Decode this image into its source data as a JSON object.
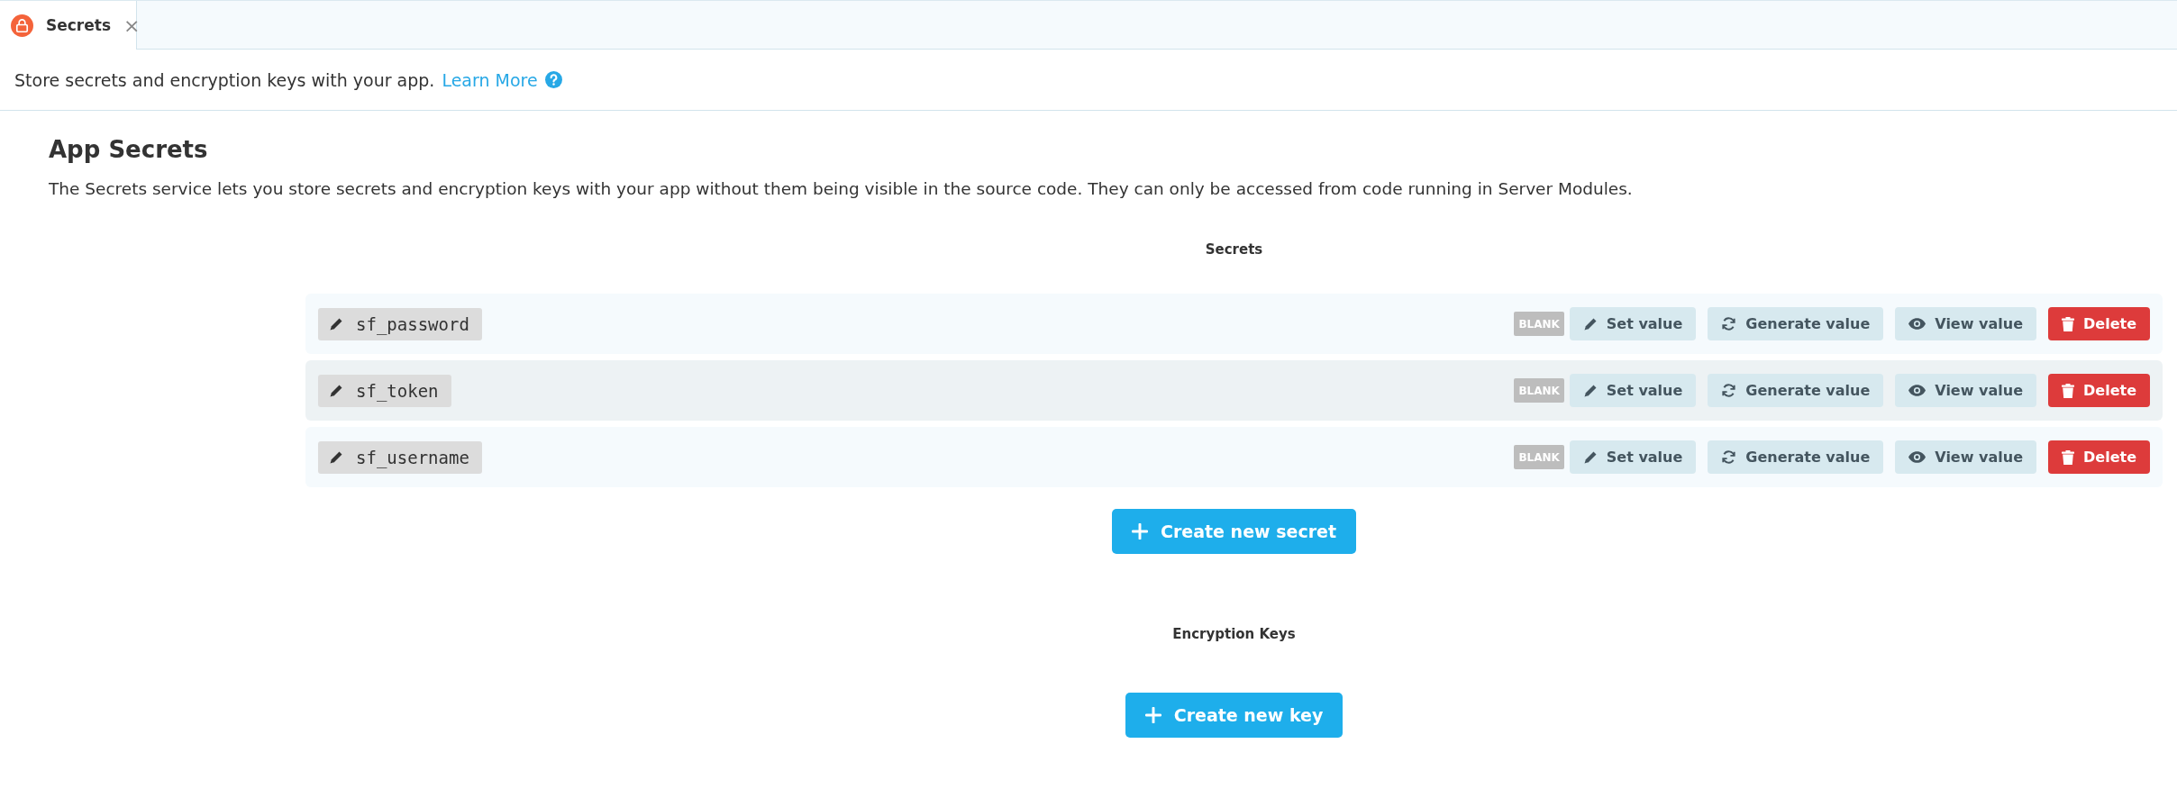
{
  "tab": {
    "label": "Secrets",
    "selected": true,
    "close": "×"
  },
  "intro": {
    "text": "Store secrets and encryption keys with your app.",
    "link": "Learn More"
  },
  "title": "App Secrets",
  "description": "The Secrets service lets you store secrets and encryption keys with your app without them being visible in the source code. They can only be accessed from code running in Server Modules.",
  "secrets": {
    "heading": "Secrets",
    "rows": [
      {
        "name": "sf_password",
        "badge": "BLANK",
        "actions": [
          {
            "kind": "set",
            "label": "Set value"
          },
          {
            "kind": "generate",
            "label": "Generate value"
          },
          {
            "kind": "view",
            "label": "View value"
          },
          {
            "kind": "delete",
            "label": "Delete"
          }
        ]
      },
      {
        "name": "sf_token",
        "badge": "BLANK",
        "actions": [
          {
            "kind": "set",
            "label": "Set value"
          },
          {
            "kind": "generate",
            "label": "Generate value"
          },
          {
            "kind": "view",
            "label": "View value"
          },
          {
            "kind": "delete",
            "label": "Delete"
          }
        ]
      },
      {
        "name": "sf_username",
        "badge": "BLANK",
        "actions": [
          {
            "kind": "set",
            "label": "Set value"
          },
          {
            "kind": "generate",
            "label": "Generate value"
          },
          {
            "kind": "view",
            "label": "View value"
          },
          {
            "kind": "delete",
            "label": "Delete"
          }
        ]
      }
    ],
    "create": "Create new secret"
  },
  "keys": {
    "heading": "Encryption Keys",
    "create": "Create new key"
  }
}
